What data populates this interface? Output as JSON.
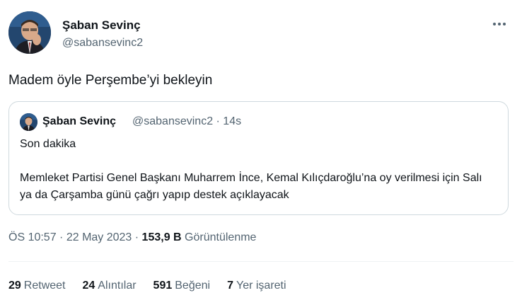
{
  "author": {
    "name": "Şaban Sevinç",
    "handle": "@sabansevinc2"
  },
  "tweet": {
    "text": "Madem öyle Perşembe’yi bekleyin"
  },
  "quoted": {
    "name": "Şaban Sevinç",
    "meta": "@sabansevinc2 · 14s",
    "line1": "Son dakika",
    "line2": "Memleket Partisi Genel Başkanı Muharrem İnce, Kemal Kılıçdaroğlu’na oy verilmesi için Salı ya da Çarşamba günü çağrı yapıp destek açıklayacak"
  },
  "meta": {
    "time": "ÖS 10:57 · 22 May 2023 · ",
    "views_count": "153,9 B",
    "views_label": "Görüntülenme"
  },
  "stats": {
    "retweets_count": "29",
    "retweets_label": "Retweet",
    "quotes_count": "24",
    "quotes_label": "Alıntılar",
    "likes_count": "591",
    "likes_label": "Beğeni",
    "bookmarks_count": "7",
    "bookmarks_label": "Yer işareti"
  },
  "icons": {
    "more": "more-dots-icon",
    "avatar": "profile-photo"
  }
}
